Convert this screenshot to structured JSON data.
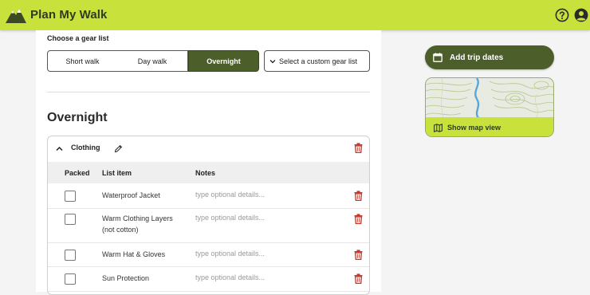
{
  "app": {
    "name": "Plan My Walk"
  },
  "header": {
    "help_icon": "question-circle-icon",
    "account_icon": "user-circle-icon"
  },
  "gear_selector": {
    "label": "Choose a gear list",
    "options": [
      "Short walk",
      "Day walk",
      "Overnight"
    ],
    "selected": "Overnight",
    "custom_select_label": "Select a custom gear list"
  },
  "section": {
    "title": "Overnight"
  },
  "category": {
    "name": "Clothing",
    "columns": {
      "packed": "Packed",
      "item": "List item",
      "notes": "Notes"
    },
    "notes_placeholder": "type optional details...",
    "items": [
      {
        "name": "Waterproof Jacket",
        "packed": false
      },
      {
        "name": "Warm Clothing Layers (not cotton)",
        "packed": false
      },
      {
        "name": "Warm Hat & Gloves",
        "packed": false
      },
      {
        "name": "Sun Protection",
        "packed": false
      }
    ]
  },
  "sidebar": {
    "add_dates_label": "Add trip dates",
    "map_label": "Show map view"
  },
  "colors": {
    "brand_lime": "#c9e23b",
    "brand_dark_green": "#4c5e2a",
    "delete_red": "#c0392b"
  }
}
